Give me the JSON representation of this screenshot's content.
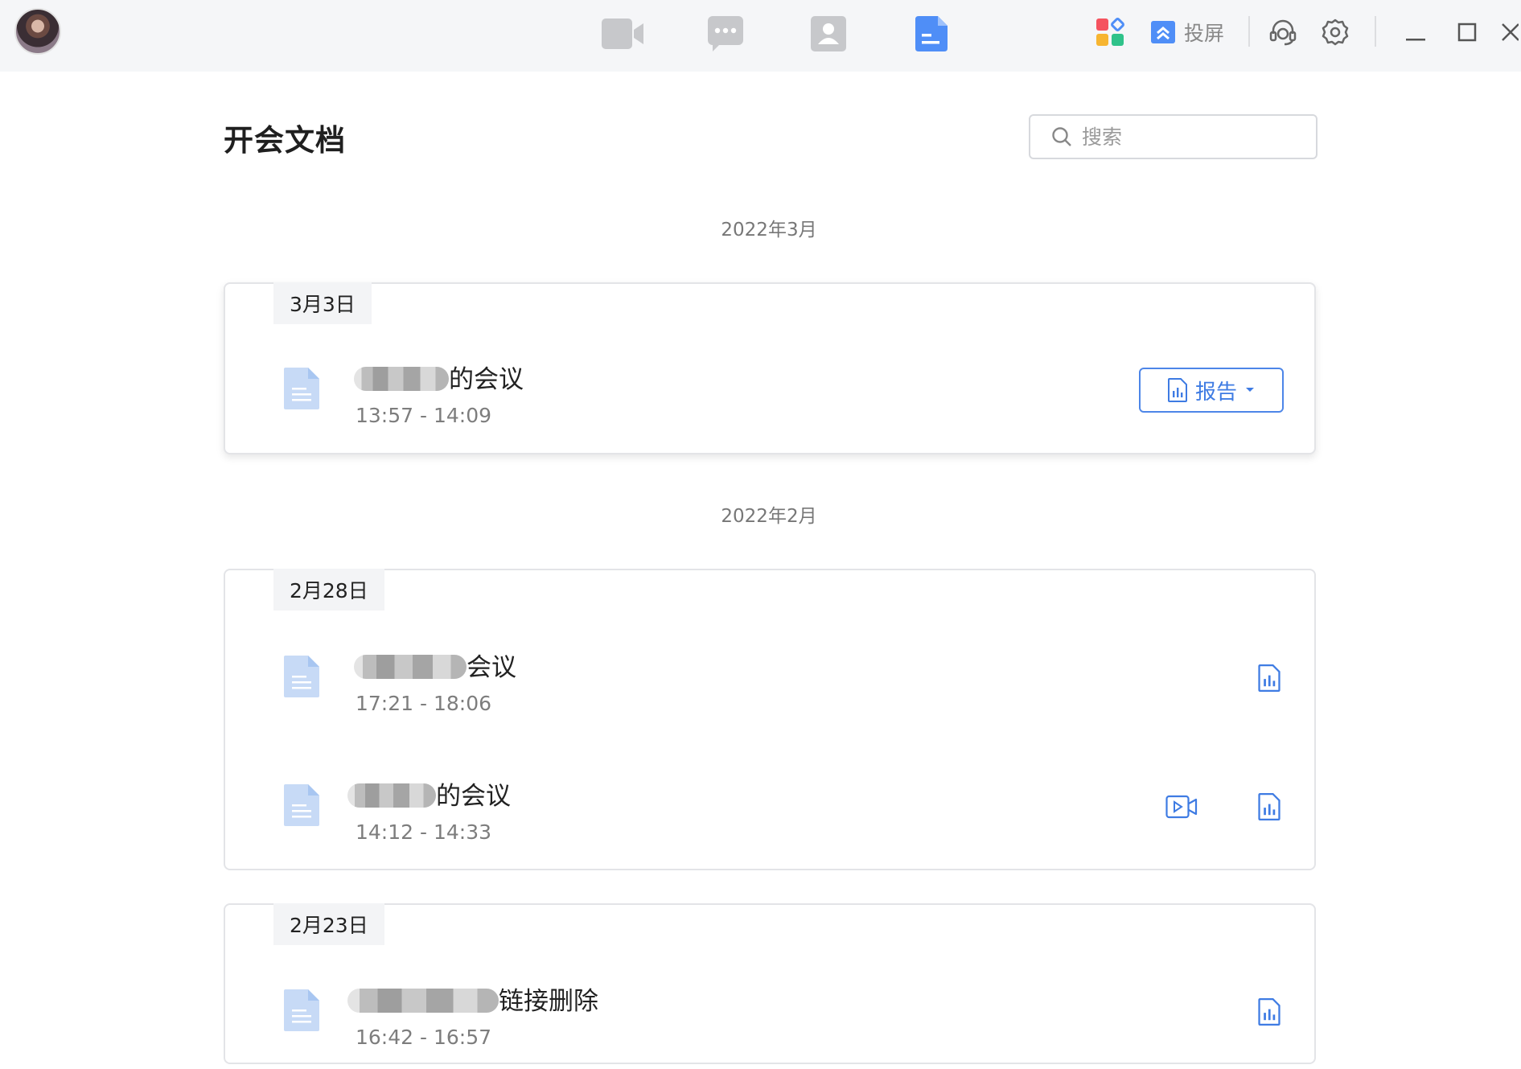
{
  "colors": {
    "accent": "#3e7be3",
    "nav_inactive": "#c7c8cb",
    "doc_icon": "#c7daf6",
    "topbar_bg": "#f5f6f8"
  },
  "topbar": {
    "nav": [
      {
        "name": "video-meeting-icon",
        "active": false
      },
      {
        "name": "chat-icon",
        "active": false
      },
      {
        "name": "contacts-icon",
        "active": false
      },
      {
        "name": "documents-icon",
        "active": true
      }
    ],
    "cast_label": "投屏",
    "icons": [
      "apps-icon",
      "cast-icon",
      "headset-icon",
      "gear-icon",
      "minimize-icon",
      "maximize-icon",
      "close-icon"
    ]
  },
  "page": {
    "title": "开会文档",
    "search_placeholder": "搜索"
  },
  "groups": [
    {
      "month": "2022年3月",
      "days": [
        {
          "date": "3月3日",
          "items": [
            {
              "title_suffix": "的会议",
              "time": "13:57 - 14:09",
              "report_label": "报告"
            }
          ]
        }
      ]
    },
    {
      "month": "2022年2月",
      "days": [
        {
          "date": "2月28日",
          "items": [
            {
              "title_suffix": "会议",
              "time": "17:21 - 18:06"
            },
            {
              "title_suffix": "的会议",
              "time": "14:12 - 14:33"
            }
          ]
        },
        {
          "date": "2月23日",
          "items": [
            {
              "title_suffix": "链接删除",
              "time": "16:42 - 16:57"
            }
          ]
        }
      ]
    }
  ]
}
